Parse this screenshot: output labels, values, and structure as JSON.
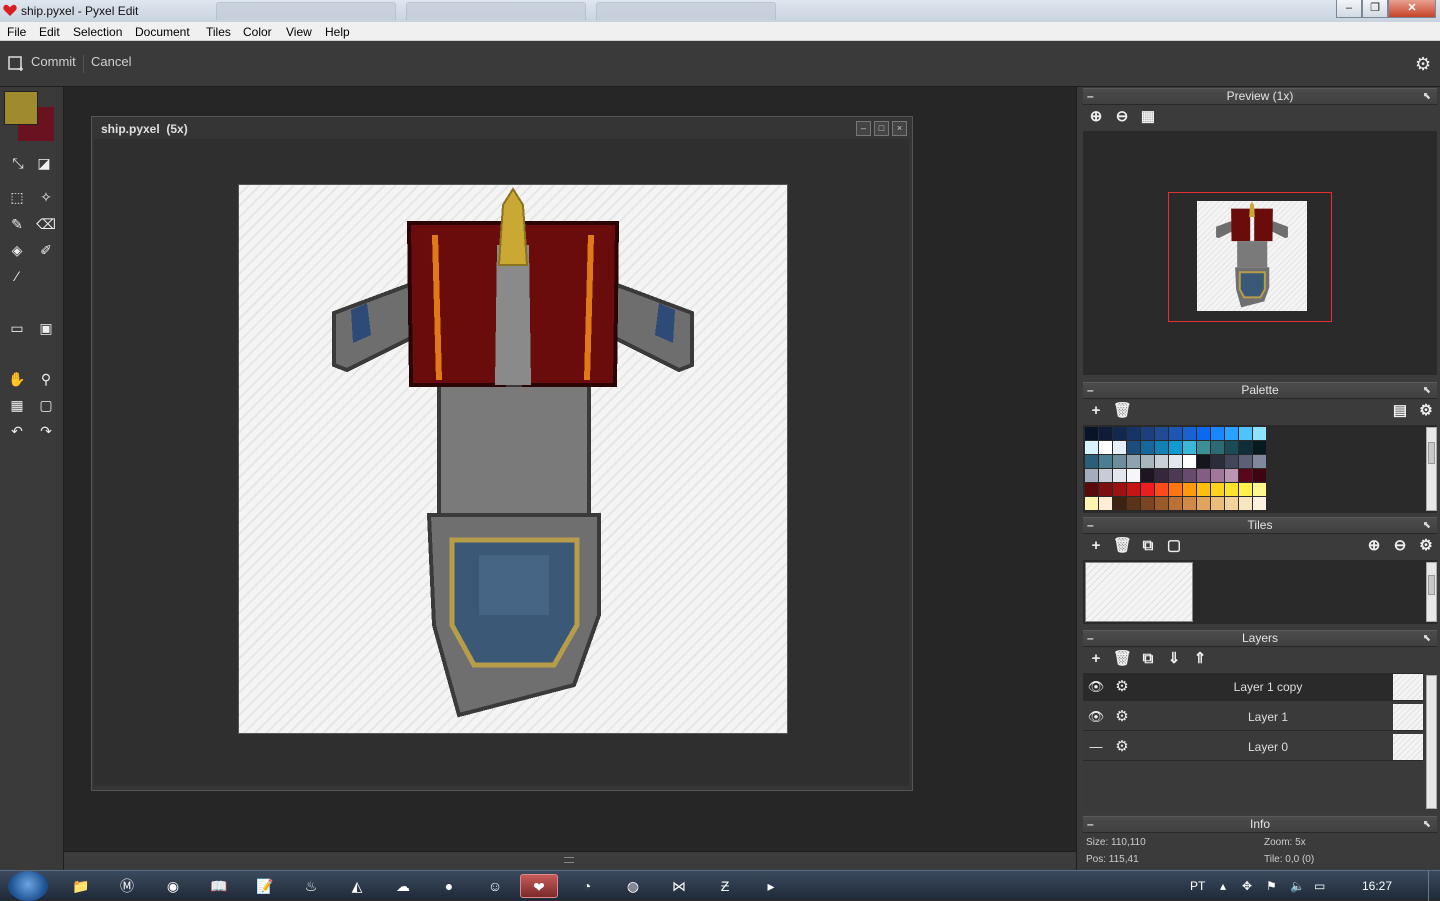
{
  "window": {
    "title": "ship.pyxel - Pyxel Edit",
    "controls": [
      "minimize",
      "maximize",
      "close"
    ]
  },
  "menu": [
    "File",
    "Edit",
    "Selection",
    "Document",
    "Tiles",
    "Color",
    "View",
    "Help"
  ],
  "toolbar": {
    "commit_label": "Commit",
    "cancel_label": "Cancel"
  },
  "colors": {
    "primary": "#a08a2e",
    "secondary": "#6b1220",
    "accent_selection": "#e53030"
  },
  "document": {
    "title": "ship.pyxel",
    "zoom": "(5x)"
  },
  "panels": {
    "preview": {
      "title": "Preview (1x)"
    },
    "palette": {
      "title": "Palette",
      "rows": [
        [
          "#0a1428",
          "#0e1c3a",
          "#13284f",
          "#173466",
          "#1c3f7d",
          "#214b94",
          "#1e57b3",
          "#1a62d1",
          "#0c68ee",
          "#1b87ff",
          "#29a3ff",
          "#4fc3ff",
          "#8fe3ff"
        ],
        [
          "#d6f3ff",
          "#ffffff",
          "#e8f0f8",
          "#1e4d7a",
          "#18679a",
          "#1381b5",
          "#0f9bd0",
          "#39b6d9",
          "#3e8e97",
          "#2c6b75",
          "#1c4a55",
          "#0e2e38",
          "#071a20"
        ],
        [
          "#2b5e78",
          "#4b7e93",
          "#6d8d9a",
          "#8ea3ad",
          "#a8b6bd",
          "#c7d1d6",
          "#e2e8eb",
          "#ffffff",
          "#15161d",
          "#2b2d3b",
          "#434658",
          "#5b6074",
          "#82889c"
        ],
        [
          "#a6acbd",
          "#c8ccd7",
          "#e3e6ec",
          "#f6f6f8",
          "#1e1523",
          "#36273c",
          "#4e3955",
          "#674a6e",
          "#835d84",
          "#a1779c",
          "#b995b1",
          "#58081a",
          "#3e0410"
        ],
        [
          "#5a0a0a",
          "#7c0f0f",
          "#9c1212",
          "#c51515",
          "#ea1e1e",
          "#ff4a1a",
          "#ff7512",
          "#ff9a0c",
          "#ffbf10",
          "#ffd31c",
          "#ffe22a",
          "#fff24c",
          "#fff88f"
        ],
        [
          "#fff3b0",
          "#ffeed4",
          "#3b2211",
          "#5a3318",
          "#7a4520",
          "#9b5a2a",
          "#bb7136",
          "#d08a47",
          "#e1a45e",
          "#ebbd7b",
          "#f2d39b",
          "#f7e6bf",
          "#fbf3df"
        ]
      ]
    },
    "tiles": {
      "title": "Tiles"
    },
    "layers": {
      "title": "Layers",
      "items": [
        {
          "name": "Layer 1 copy",
          "visible": true,
          "selected": true
        },
        {
          "name": "Layer 1",
          "visible": true,
          "selected": false
        },
        {
          "name": "Layer 0",
          "visible": false,
          "selected": false
        }
      ]
    },
    "info": {
      "title": "Info",
      "size": "Size: 110,110",
      "pos": "Pos: 115,41",
      "zoom": "Zoom: 5x",
      "tile": "Tile: 0,0 (0)"
    }
  },
  "taskbar": {
    "language": "PT",
    "clock": "16:27"
  }
}
